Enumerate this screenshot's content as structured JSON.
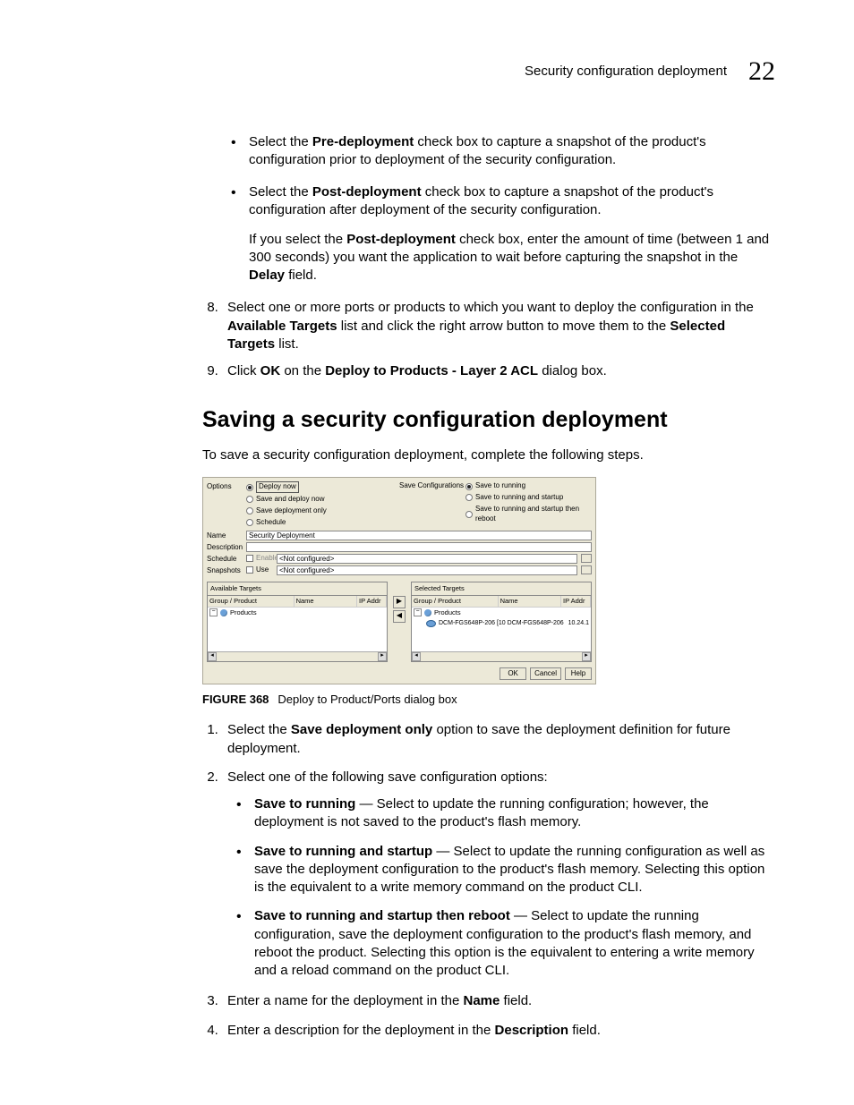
{
  "header": {
    "title": "Security configuration deployment",
    "page_num": "22"
  },
  "bullets_top": [
    {
      "parts": [
        "Select the ",
        "Pre-deployment",
        " check box to capture a snapshot of the product's configuration prior to deployment of the security configuration."
      ]
    },
    {
      "parts": [
        "Select the ",
        "Post-deployment",
        " check box to capture a snapshot of the product's configuration after deployment of the security configuration."
      ],
      "sub": [
        "If you select the ",
        "Post-deployment",
        " check box, enter the amount of time (between 1 and 300 seconds) you want the application to wait before capturing the snapshot in the ",
        "Delay",
        " field."
      ]
    }
  ],
  "steps1": [
    {
      "num": "8.",
      "parts": [
        "Select one or more ports or products to which you want to deploy the configuration in the ",
        "Available Targets",
        " list and click the right arrow button to move them to the ",
        "Selected Targets",
        " list."
      ]
    },
    {
      "num": "9.",
      "parts": [
        "Click ",
        "OK",
        " on the ",
        "Deploy to Products - Layer 2 ACL",
        " dialog box."
      ]
    }
  ],
  "section": "Saving a security configuration deployment",
  "intro": "To save a security configuration deployment, complete the following steps.",
  "figure": {
    "options_label": "Options",
    "options": [
      "Deploy now",
      "Save and deploy now",
      "Save deployment only",
      "Schedule"
    ],
    "save_cfg_label": "Save Configurations",
    "save_cfg": [
      "Save to running",
      "Save to running and startup",
      "Save to running and startup then reboot"
    ],
    "name_label": "Name",
    "name_value": "Security Deployment",
    "desc_label": "Description",
    "desc_value": "",
    "sched_label": "Schedule",
    "sched_chk": "Enable",
    "sched_val": "<Not configured>",
    "snap_label": "Snapshots",
    "snap_chk": "Use",
    "snap_val": "<Not configured>",
    "avail_title": "Available Targets",
    "sel_title": "Selected Targets",
    "cols": {
      "group": "Group / Product",
      "name": "Name",
      "ip": "IP Addr"
    },
    "products": "Products",
    "sel_item": {
      "label": "DCM-FGS648P-206 [10 DCM-FGS648P-206",
      "ip": "10.24.1"
    },
    "buttons": {
      "ok": "OK",
      "cancel": "Cancel",
      "help": "Help"
    }
  },
  "caption": {
    "label": "FIGURE 368",
    "text": "Deploy to Product/Ports dialog box"
  },
  "steps2": [
    {
      "parts": [
        "Select the ",
        "Save deployment only",
        " option to save the deployment definition for future deployment."
      ]
    },
    {
      "parts": [
        "Select one of the following save configuration options:"
      ],
      "inner": [
        {
          "parts": [
            "Save to running",
            " — Select to update the running configuration; however, the deployment is not saved to the product's flash memory."
          ]
        },
        {
          "parts": [
            "Save to running and startup",
            " — Select to update the running configuration as well as save the deployment configuration to the product's flash memory. Selecting this option is the equivalent to a write memory command on the product CLI."
          ]
        },
        {
          "parts": [
            "Save to running and startup then reboot",
            " — Select to update the running configuration, save the deployment configuration to the product's flash memory, and reboot the product. Selecting this option is the equivalent to entering a write memory and a reload command on the product CLI."
          ]
        }
      ]
    },
    {
      "parts": [
        "Enter a name for the deployment in the ",
        "Name",
        " field."
      ]
    },
    {
      "parts": [
        "Enter a description for the deployment in the ",
        "Description",
        " field."
      ]
    }
  ]
}
